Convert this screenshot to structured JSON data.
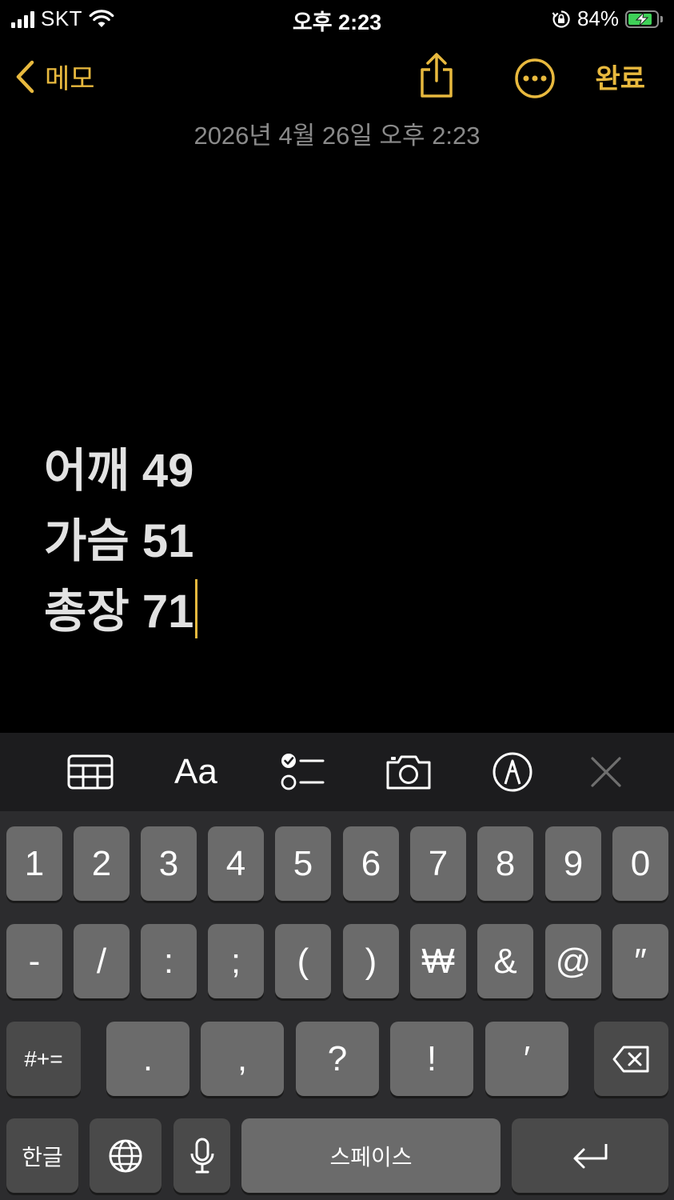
{
  "status_bar": {
    "carrier": "SKT",
    "time": "오후 2:23",
    "battery_percent": "84%",
    "battery_level": 0.84,
    "charging": true
  },
  "nav": {
    "back_label": "메모",
    "done_label": "완료",
    "share_icon": "share-icon",
    "more_icon": "ellipsis-circle-icon"
  },
  "note": {
    "date": "2026년 4월 26일 오후 2:23",
    "lines": [
      "어깨 49",
      "가슴 51",
      "총장 71"
    ]
  },
  "toolbar": {
    "icons": [
      "table-icon",
      "text-format-icon",
      "checklist-icon",
      "camera-icon",
      "markup-icon",
      "close-icon"
    ],
    "format_label": "Aa"
  },
  "keyboard": {
    "row1": [
      "1",
      "2",
      "3",
      "4",
      "5",
      "6",
      "7",
      "8",
      "9",
      "0"
    ],
    "row2": [
      "-",
      "/",
      ":",
      ";",
      "(",
      ")",
      "₩",
      "&",
      "@",
      "″"
    ],
    "row3": [
      ".",
      ",",
      "?",
      "!",
      "′"
    ],
    "symbols_label": "#+=",
    "lang_label": "한글",
    "space_label": "스페이스"
  },
  "colors": {
    "accent": "#e8b93e",
    "background": "#000000",
    "keyboard_bg": "#2c2c2e",
    "key": "#6b6b6b",
    "key_dark": "#4a4a4a"
  }
}
